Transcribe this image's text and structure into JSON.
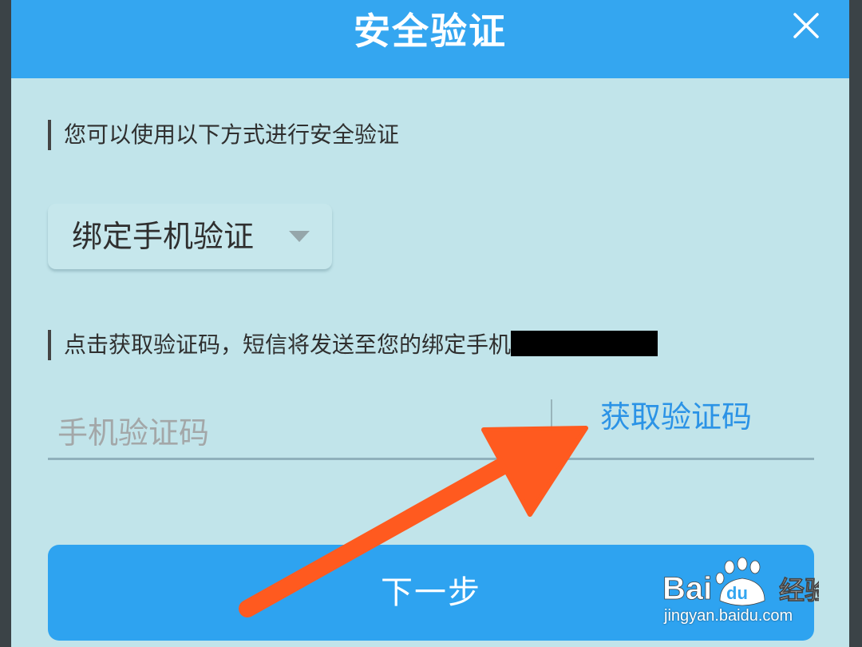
{
  "header": {
    "title": "安全验证",
    "close_icon": "close-icon"
  },
  "verify": {
    "intro": "您可以使用以下方式进行安全验证",
    "method_selected": "绑定手机验证",
    "sms_hint": "点击获取验证码，短信将发送至您的绑定手机"
  },
  "code_field": {
    "placeholder": "手机验证码",
    "value": "",
    "get_code_label": "获取验证码"
  },
  "actions": {
    "next_label": "下一步"
  },
  "watermark": {
    "url": "jingyan.baidu.com"
  },
  "colors": {
    "header": "#34a6f0",
    "background": "#c1e4ea",
    "link": "#2b93e6",
    "button": "#2ea3f0",
    "arrow": "#ff5a1f"
  }
}
